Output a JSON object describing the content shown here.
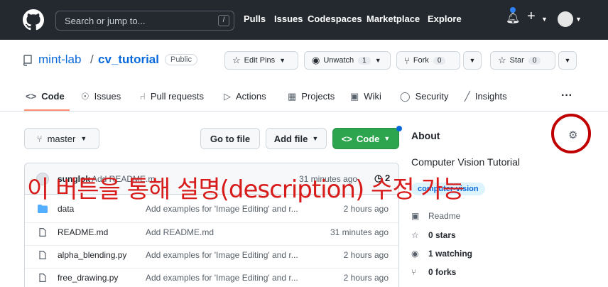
{
  "header": {
    "search_placeholder": "Search or jump to...",
    "search_key": "/",
    "nav": [
      "Pulls",
      "Issues",
      "Codespaces",
      "Marketplace",
      "Explore"
    ]
  },
  "repo": {
    "owner": "mint-lab",
    "separator": "/",
    "name": "cv_tutorial",
    "visibility": "Public",
    "edit_pins": "Edit Pins",
    "unwatch": "Unwatch",
    "unwatch_count": "1",
    "fork": "Fork",
    "fork_count": "0",
    "star": "Star",
    "star_count": "0"
  },
  "tabs": [
    "Code",
    "Issues",
    "Pull requests",
    "Actions",
    "Projects",
    "Wiki",
    "Security",
    "Insights"
  ],
  "actions": {
    "branch": "master",
    "go_to_file": "Go to file",
    "add_file": "Add file",
    "code": "Code"
  },
  "latest_commit": {
    "author": "sunglok",
    "message": "Add README.m...",
    "time": "31 minutes ago",
    "count": "2"
  },
  "files": [
    {
      "name": "data",
      "type": "folder",
      "message": "Add examples for 'Image Editing' and r...",
      "time": "2 hours ago"
    },
    {
      "name": "README.md",
      "type": "file",
      "message": "Add README.md",
      "time": "31 minutes ago"
    },
    {
      "name": "alpha_blending.py",
      "type": "file",
      "message": "Add examples for 'Image Editing' and r...",
      "time": "2 hours ago"
    },
    {
      "name": "free_drawing.py",
      "type": "file",
      "message": "Add examples for 'Image Editing' and r...",
      "time": "2 hours ago"
    }
  ],
  "about": {
    "title": "About",
    "description": "Computer Vision Tutorial",
    "topic": "computer-vision",
    "readme": "Readme",
    "stars": "0 stars",
    "watching": "1 watching",
    "forks": "0 forks"
  },
  "annotation": "이 버튼을 통해 설명(description) 수정 가능",
  "colors": {
    "header_bg": "#24292f",
    "link": "#0969da",
    "green": "#2da44e",
    "annotation_red": "#d81b1b"
  }
}
